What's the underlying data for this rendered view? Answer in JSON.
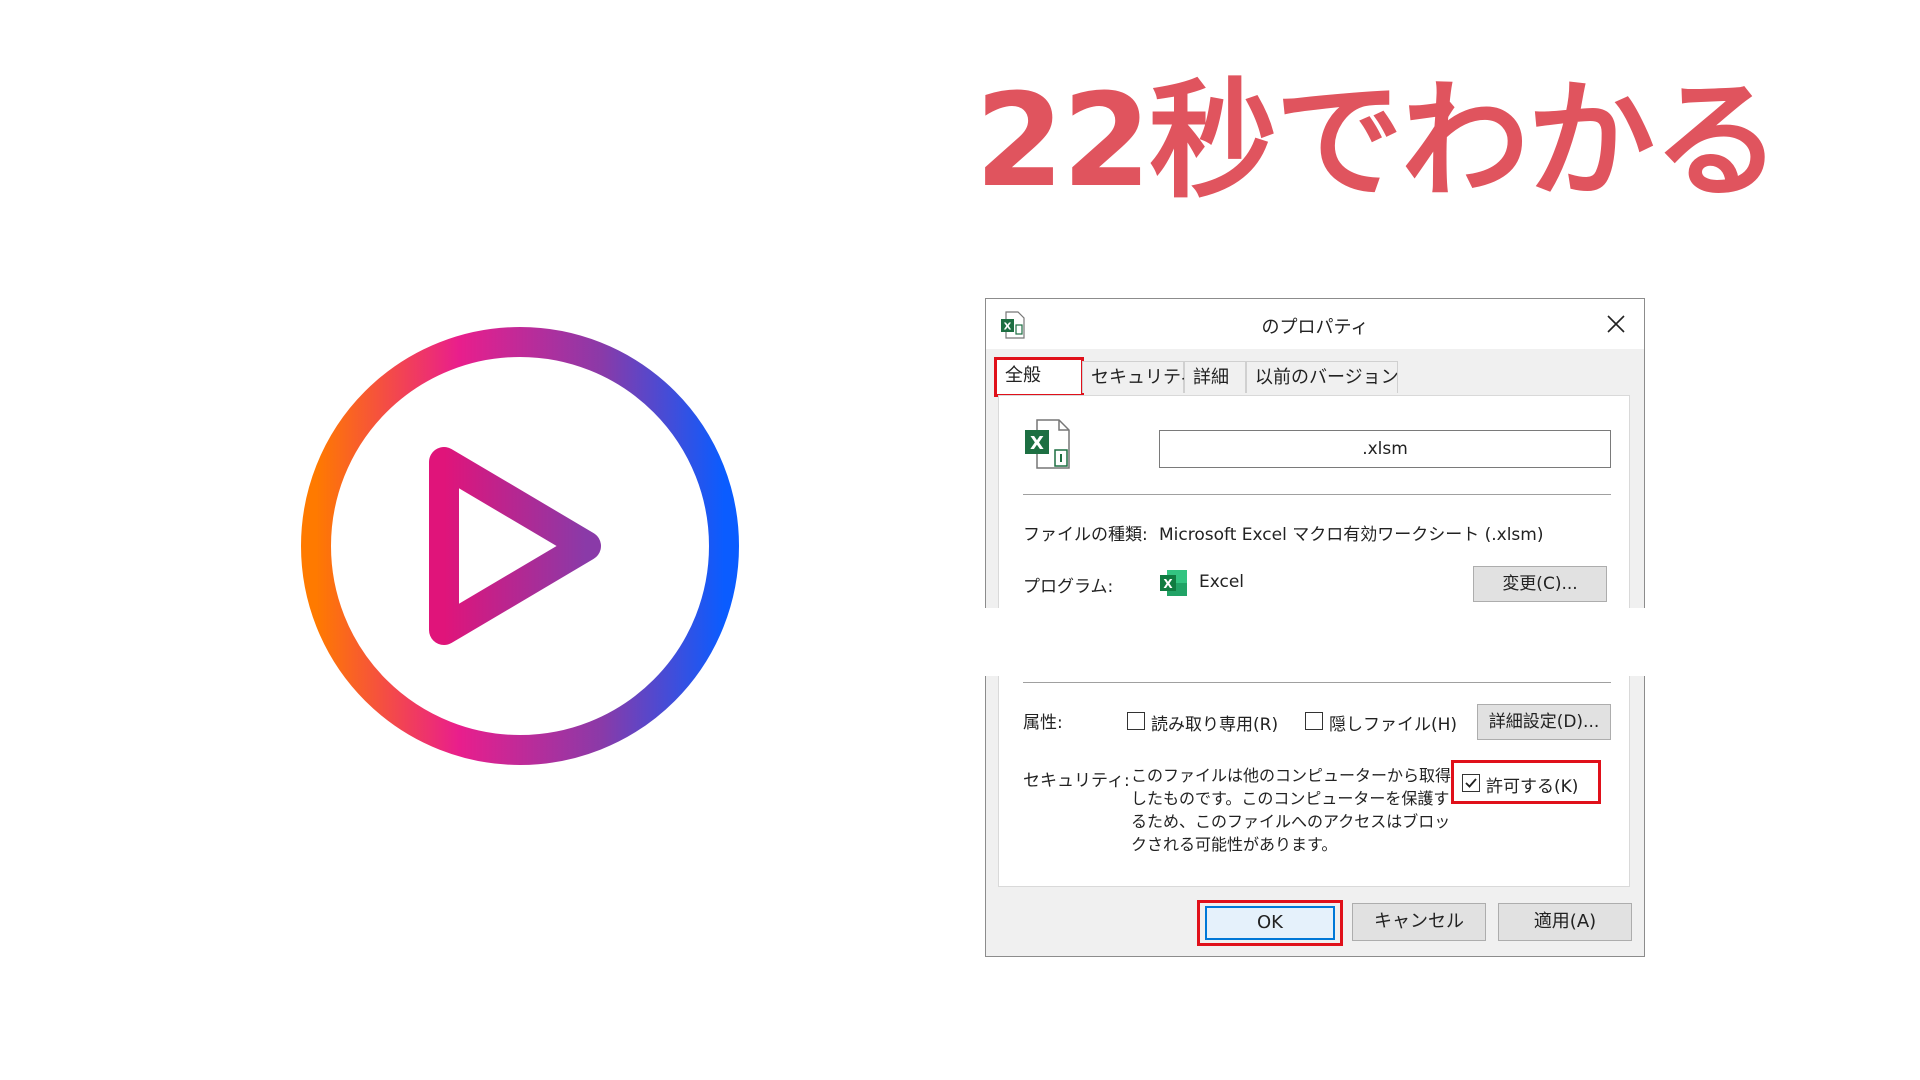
{
  "headline": "22秒でわかる",
  "colors": {
    "headline": "#e0545e",
    "highlight": "#e0101a",
    "focus": "#0078d7",
    "excel_green": "#1d6f42",
    "logo_orange": "#ff7a00",
    "logo_magenta": "#e91e8c",
    "logo_blue": "#0a5cff"
  },
  "logo": {
    "icon": "play-circle-icon"
  },
  "dialog": {
    "title": "のプロパティ",
    "title_icon": "excel-file-icon",
    "close_icon": "close-icon",
    "tabs": [
      {
        "label": "全般",
        "active": true
      },
      {
        "label": "セキュリティ",
        "active": false
      },
      {
        "label": "詳細",
        "active": false
      },
      {
        "label": "以前のバージョン",
        "active": false
      }
    ],
    "general": {
      "file_name": ".xlsm",
      "file_type_label": "ファイルの種類:",
      "file_type_value": "Microsoft Excel マクロ有効ワークシート (.xlsm)",
      "program_label": "プログラム:",
      "program_value": "Excel",
      "program_icon": "excel-app-icon",
      "change_button": "変更(C)...",
      "attributes_label": "属性:",
      "readonly_label": "読み取り専用(R)",
      "readonly_checked": false,
      "hidden_label": "隠しファイル(H)",
      "hidden_checked": false,
      "advanced_button": "詳細設定(D)...",
      "security_label": "セキュリティ:",
      "security_text": "このファイルは他のコンピューターから取得したものです。このコンピューターを保護するため、このファイルへのアクセスはブロックされる可能性があります。",
      "allow_label": "許可する(K)",
      "allow_checked": true
    },
    "footer": {
      "ok": "OK",
      "cancel": "キャンセル",
      "apply": "適用(A)"
    }
  }
}
